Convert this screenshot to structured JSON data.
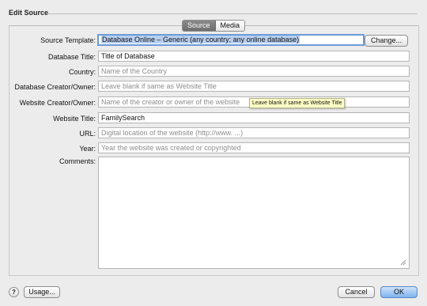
{
  "window": {
    "title": "Edit Source"
  },
  "tabs": [
    {
      "label": "Source"
    },
    {
      "label": "Media"
    }
  ],
  "form": {
    "source_template": {
      "label": "Source Template:",
      "value": "Database Online – Generic (any country; any online database)"
    },
    "database_title": {
      "label": "Database Title:",
      "value": "Title of Database"
    },
    "country": {
      "label": "Country:",
      "placeholder": "Name of the Country"
    },
    "database_creator": {
      "label": "Database Creator/Owner:",
      "placeholder": "Leave blank if same as Website Title"
    },
    "website_creator": {
      "label": "Website Creator/Owner:",
      "placeholder": "Name of the creator or owner of the website"
    },
    "website_title": {
      "label": "Website Title:",
      "value": "FamilySearch"
    },
    "url": {
      "label": "URL:",
      "placeholder": "Digital location of the website (http://www. ...)"
    },
    "year": {
      "label": "Year:",
      "placeholder": "Year the website was created or copyrighted"
    },
    "comments": {
      "label": "Comments:"
    }
  },
  "tooltip": {
    "text": "Leave blank if same as Website Title"
  },
  "buttons": {
    "change": "Change...",
    "usage": "Usage...",
    "cancel": "Cancel",
    "ok": "OK",
    "help": "?"
  }
}
